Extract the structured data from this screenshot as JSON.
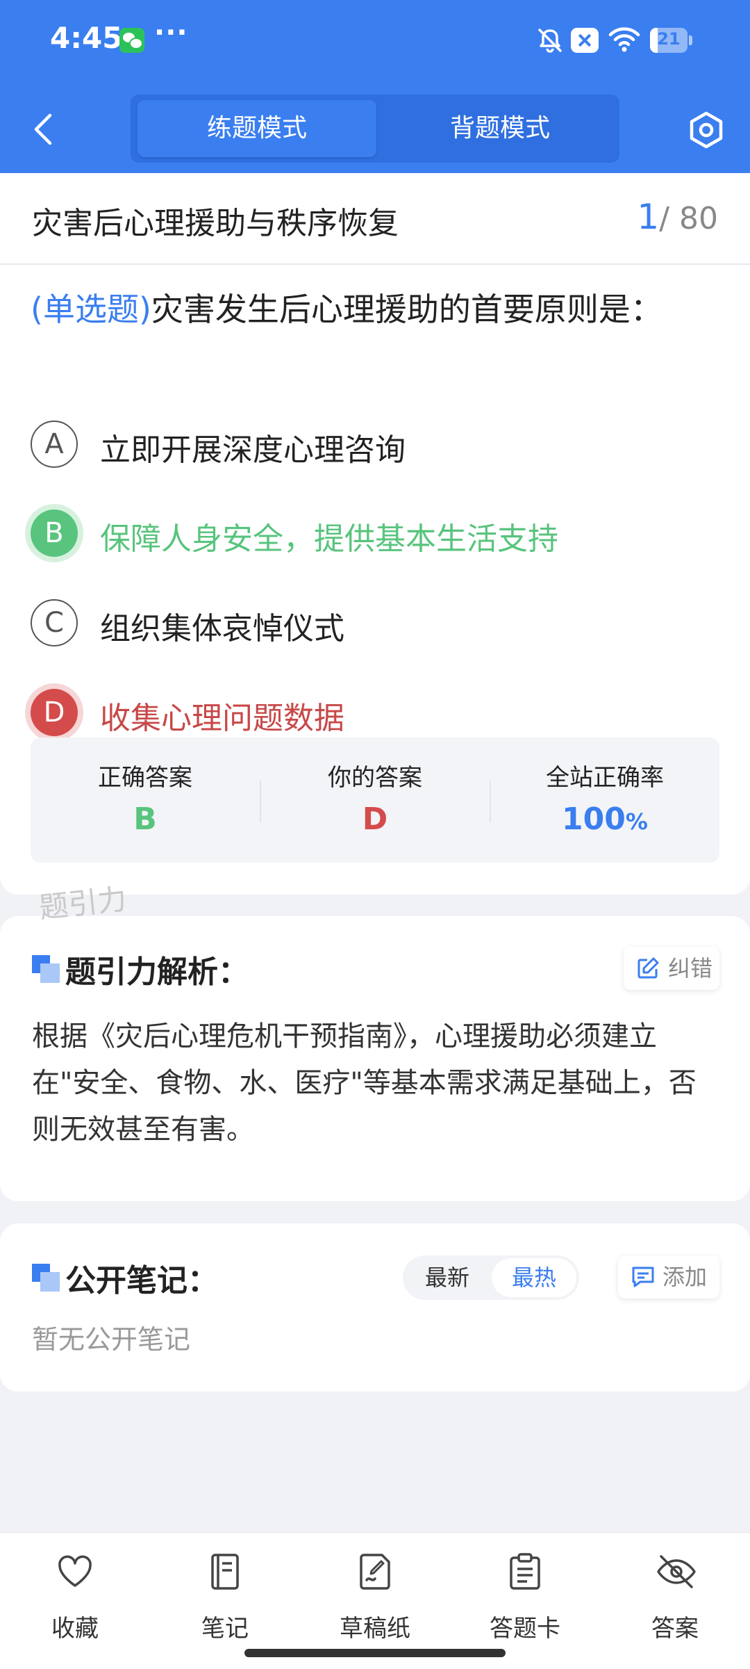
{
  "status_bar": {
    "time": "4:45",
    "more": "···",
    "battery": "21",
    "icons": [
      "wechat-icon",
      "mute-icon",
      "close-notification-icon",
      "wifi-icon",
      "battery-icon"
    ]
  },
  "header": {
    "modes": [
      "练题模式",
      "背题模式"
    ],
    "active_mode": "练题模式"
  },
  "question": {
    "chapter_title": "灾害后心理援助与秩序恢复",
    "current": "1",
    "total": "/ 80",
    "type": "(单选题)",
    "text": "灾害发生后心理援助的首要原则是：",
    "options": [
      {
        "letter": "A",
        "text": "立即开展深度心理咨询",
        "state": "normal"
      },
      {
        "letter": "B",
        "text": "保障人身安全，提供基本生活支持",
        "state": "correct"
      },
      {
        "letter": "C",
        "text": "组织集体哀悼仪式",
        "state": "normal"
      },
      {
        "letter": "D",
        "text": "收集心理问题数据",
        "state": "wrong"
      }
    ]
  },
  "stats": {
    "correct_label": "正确答案",
    "correct_value": "B",
    "yours_label": "你的答案",
    "yours_value": "D",
    "rate_label": "全站正确率",
    "rate_value": "100",
    "rate_unit": "%"
  },
  "watermark": "题引力",
  "analysis": {
    "title": "题引力解析：",
    "report_label": "纠错",
    "text": "根据《灾后心理危机干预指南》，心理援助必须建立在\"安全、食物、水、医疗\"等基本需求满足基础上，否则无效甚至有害。"
  },
  "notes": {
    "title": "公开笔记：",
    "sort_new": "最新",
    "sort_hot": "最热",
    "add_label": "添加",
    "empty": "暂无公开笔记"
  },
  "bottom_bar": [
    {
      "label": "收藏",
      "icon": "heart-icon"
    },
    {
      "label": "笔记",
      "icon": "notebook-icon"
    },
    {
      "label": "草稿纸",
      "icon": "draft-icon"
    },
    {
      "label": "答题卡",
      "icon": "clipboard-icon"
    },
    {
      "label": "答案",
      "icon": "eye-off-icon"
    }
  ],
  "colors": {
    "primary": "#3a7ef0",
    "correct": "#58c47d",
    "wrong": "#d44b4b"
  }
}
